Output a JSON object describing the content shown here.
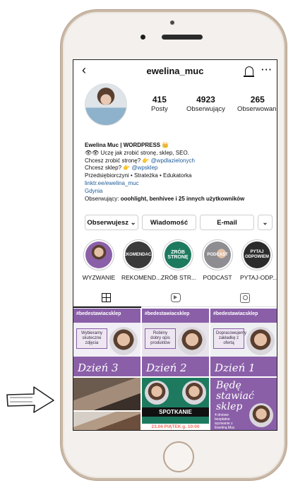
{
  "profile": {
    "username": "ewelina_muc",
    "stats": [
      {
        "num": "415",
        "label": "Posty"
      },
      {
        "num": "4923",
        "label": "Obserwujący"
      },
      {
        "num": "265",
        "label": "Obserwowani"
      }
    ],
    "bio": {
      "name": "Ewelina Muc | WORDPRESS 👑",
      "line1": "👁👁 Uczę jak zrobić stronę, sklep, SEO.",
      "line2_text": "Chcesz zrobić stronę? 👉 ",
      "line2_link": "@wpdlazielonych",
      "line3_text": "Chcesz sklep? 👉 ",
      "line3_link": "@wpsklep",
      "line4": "Przedsiębiorczyni • Strateżka • Edukatorka",
      "website": "linktr.ee/ewelina_muc",
      "location": "Gdynia",
      "followed_prefix": "Obserwujący: ",
      "followed_names": "ooohlight, benhivee i 25 innych użytkowników"
    }
  },
  "buttons": {
    "follow": "Obserwujesz ⌄",
    "message": "Wiadomość",
    "email": "E-mail",
    "more": "⌄"
  },
  "highlights": [
    {
      "caption": "WYZWANIE",
      "inner": ""
    },
    {
      "caption": "REKOMEND...",
      "inner": "REKOMENDACJE"
    },
    {
      "caption": "ZRÓB STR...",
      "inner": "ZRÓB STRONĘ"
    },
    {
      "caption": "PODCAST",
      "inner": "PODCAST"
    },
    {
      "caption": "PYTAJ-ODP...",
      "inner": "PYTAJ ODPOWIEM"
    }
  ],
  "posts": {
    "p1": {
      "tag": "#bedestawiacsklep",
      "card": "Wybieramy skuteczne zdjęcia",
      "day": "Dzień 3"
    },
    "p2": {
      "tag": "#bedestawiacsklep",
      "card": "Robimy dobry opis produktów",
      "day": "Dzień 2"
    },
    "p3": {
      "tag": "#bedestawiacsklep",
      "card": "Dopracowujemy zakładkę z ofertą",
      "day": "Dzień 1"
    },
    "p5": {
      "meet": "SPOTKANIE",
      "date": "23.04 PIĄTEK g. 10:00"
    },
    "p6": {
      "title": "Będę stawiać sklep",
      "free": "4 dniowe bezpłatne wyzwanie z Eweliną Muc"
    }
  }
}
